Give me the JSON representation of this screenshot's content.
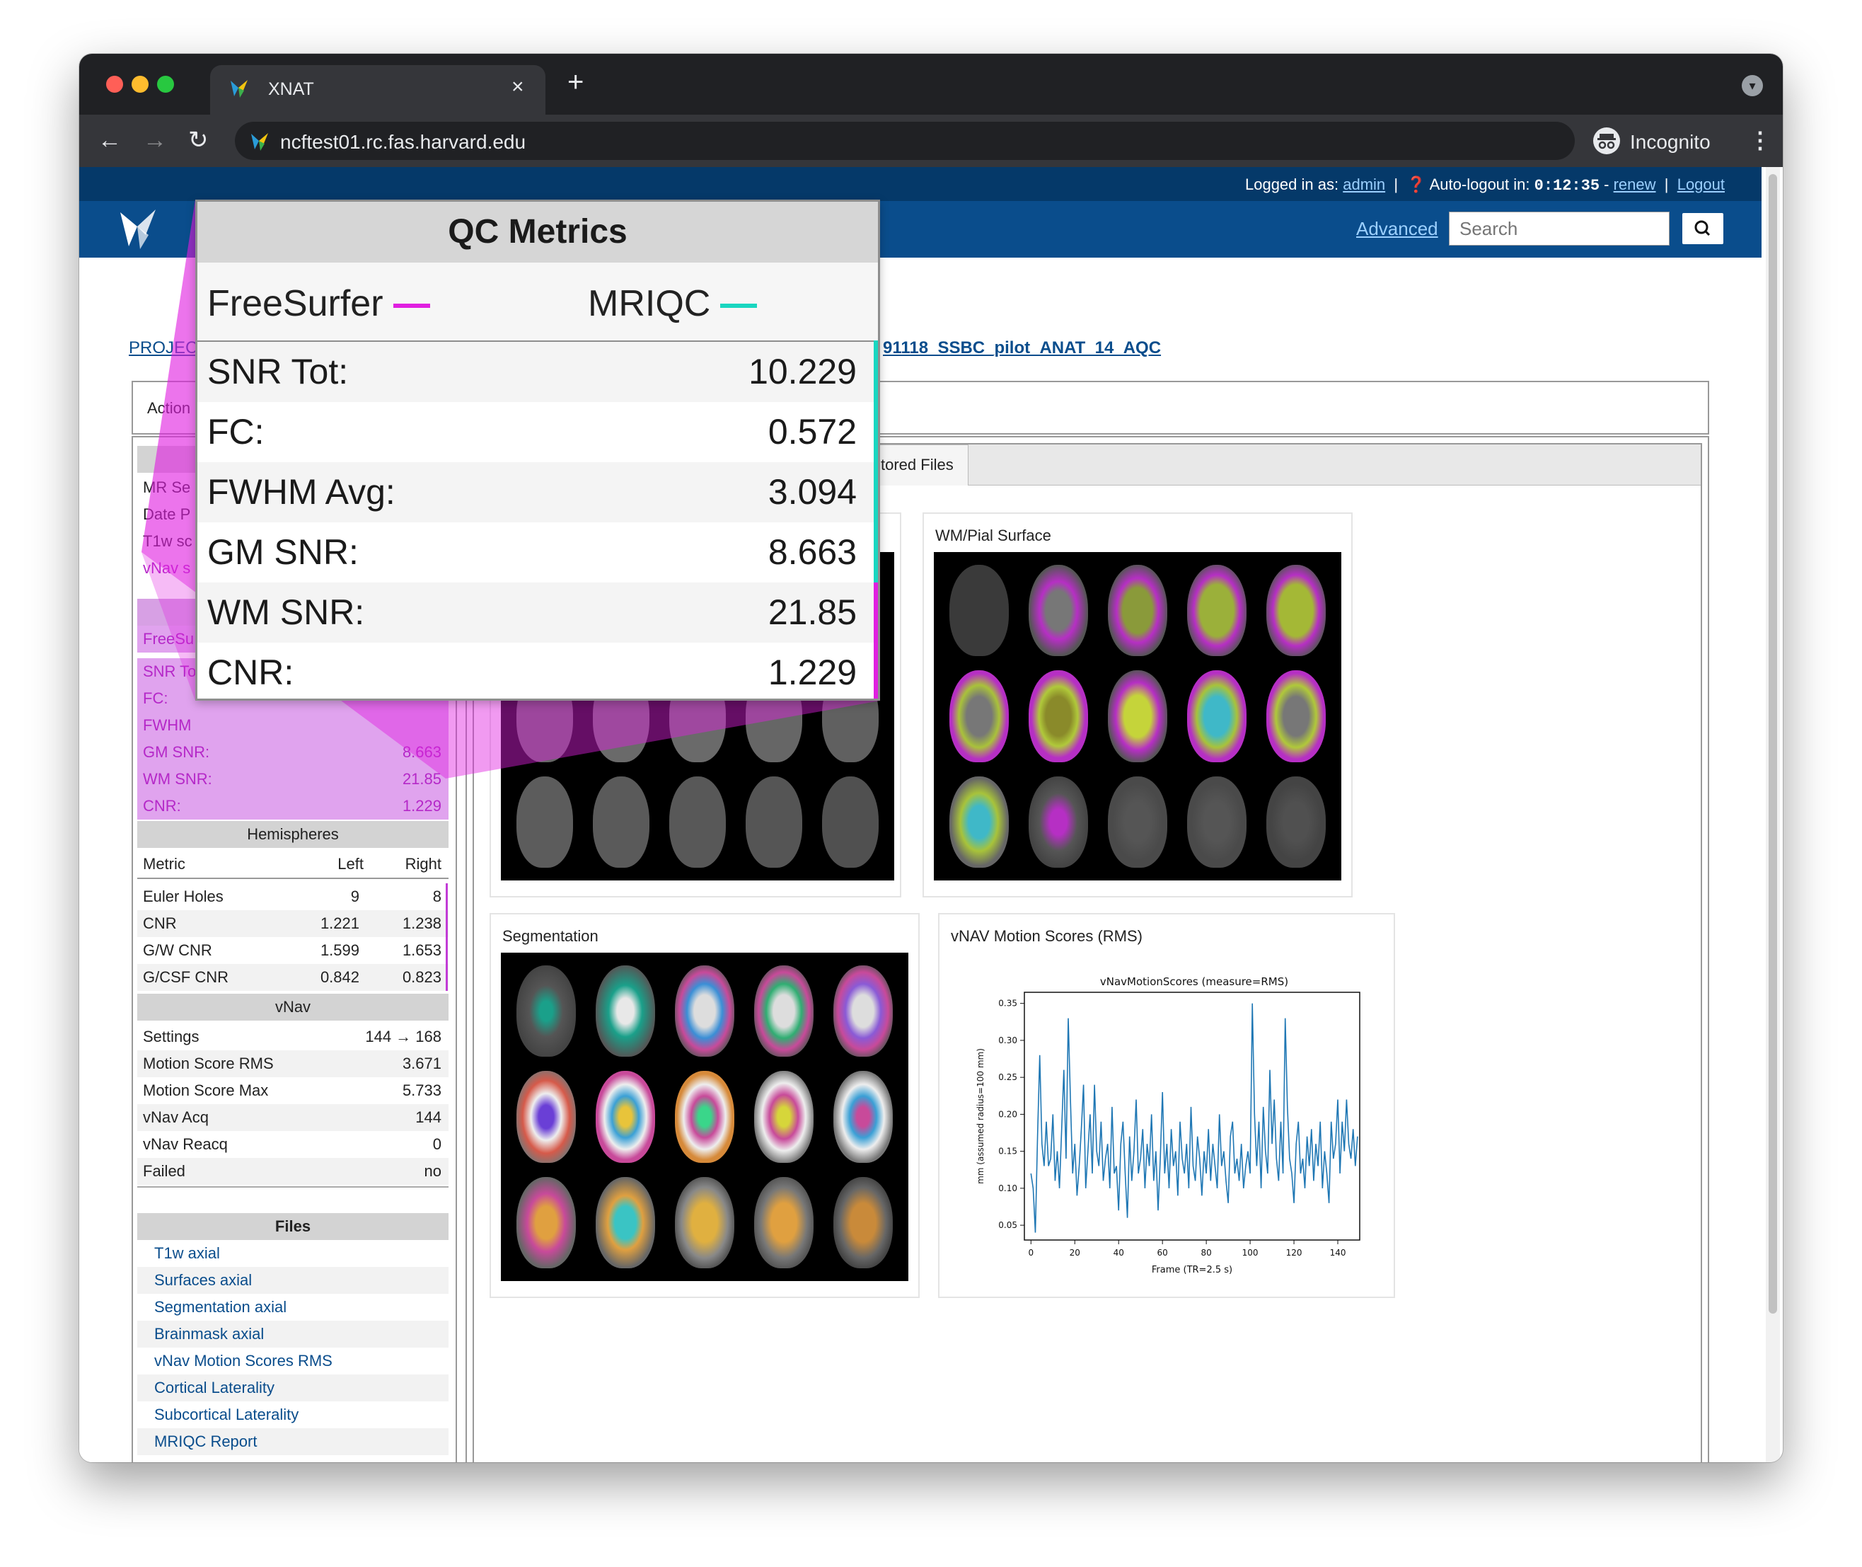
{
  "browser": {
    "tab_title": "XNAT",
    "url": "ncftest01.rc.fas.harvard.edu",
    "incognito_label": "Incognito",
    "tab_close": "×",
    "new_tab": "+"
  },
  "xnat": {
    "logged_in_label": "Logged in as:",
    "user": "admin",
    "autologout_label": "Auto-logout in:",
    "autologout_time": "0:12:35",
    "renew": "renew",
    "logout": "Logout",
    "advanced": "Advanced",
    "search_placeholder": "Search",
    "breadcrumb_project": "PROJEC",
    "breadcrumb_experiment": "91118_SSBC_pilot_ANAT_14_AQC",
    "actions_label": "Action",
    "tab_stored_files": "tored Files"
  },
  "left_panel": {
    "session_rows": [
      {
        "key": "MR Se"
      },
      {
        "key": "Date P"
      },
      {
        "key": "T1w sc"
      },
      {
        "key": "vNav s"
      }
    ],
    "freesurfer_label": "FreeSu",
    "qc_rows": [
      {
        "key": "SNR To",
        "value": ""
      },
      {
        "key": "FC:",
        "value": ""
      },
      {
        "key": "FWHM",
        "value": ""
      },
      {
        "key": "GM SNR:",
        "value": "8.663"
      },
      {
        "key": "WM SNR:",
        "value": "21.85"
      },
      {
        "key": "CNR:",
        "value": "1.229"
      }
    ],
    "hemispheres": {
      "title": "Hemispheres",
      "header": {
        "metric": "Metric",
        "left": "Left",
        "right": "Right"
      },
      "rows": [
        {
          "metric": "Euler Holes",
          "left": "9",
          "right": "8"
        },
        {
          "metric": "CNR",
          "left": "1.221",
          "right": "1.238"
        },
        {
          "metric": "G/W CNR",
          "left": "1.599",
          "right": "1.653"
        },
        {
          "metric": "G/CSF CNR",
          "left": "0.842",
          "right": "0.823"
        }
      ]
    },
    "vnav": {
      "title": "vNav",
      "rows": [
        {
          "key": "Settings",
          "value": "144 → 168"
        },
        {
          "key": "Motion Score RMS",
          "value": "3.671"
        },
        {
          "key": "Motion Score Max",
          "value": "5.733"
        },
        {
          "key": "vNav Acq",
          "value": "144"
        },
        {
          "key": "vNav Reacq",
          "value": "0"
        },
        {
          "key": "Failed",
          "value": "no"
        }
      ]
    },
    "files": {
      "title": "Files",
      "links": [
        "T1w axial",
        "Surfaces axial",
        "Segmentation axial",
        "Brainmask axial",
        "vNav Motion Scores RMS",
        "Cortical Laterality",
        "Subcortical Laterality",
        "MRIQC Report"
      ]
    }
  },
  "cards": {
    "wm_pial": "WM/Pial Surface",
    "segmentation": "Segmentation",
    "vnav_motion": "vNAV Motion Scores (RMS)"
  },
  "qc_popup": {
    "title": "QC Metrics",
    "legend_freesurfer": "FreeSurfer",
    "legend_mriqc": "MRIQC",
    "freesurfer_color": "#e01fe0",
    "mriqc_color": "#19d6c0",
    "rows": [
      {
        "key": "SNR Tot:",
        "value": "10.229"
      },
      {
        "key": "FC:",
        "value": "0.572"
      },
      {
        "key": "FWHM Avg:",
        "value": "3.094"
      },
      {
        "key": "GM SNR:",
        "value": "8.663"
      },
      {
        "key": "WM SNR:",
        "value": "21.85"
      },
      {
        "key": "CNR:",
        "value": "1.229"
      }
    ]
  },
  "chart_data": {
    "type": "line",
    "title": "vNavMotionScores (measure=RMS)",
    "xlabel": "Frame (TR=2.5 s)",
    "ylabel": "mm (assumed radius=100 mm)",
    "xlim": [
      -3,
      150
    ],
    "ylim": [
      0.03,
      0.365
    ],
    "xticks": [
      0,
      20,
      40,
      60,
      80,
      100,
      120,
      140
    ],
    "yticks": [
      0.05,
      0.1,
      0.15,
      0.2,
      0.25,
      0.3,
      0.35
    ],
    "line_color": "#1f77b4",
    "grid": false,
    "series": [
      {
        "values": [
          0.12,
          0.1,
          0.04,
          0.17,
          0.28,
          0.16,
          0.13,
          0.19,
          0.13,
          0.14,
          0.2,
          0.11,
          0.15,
          0.1,
          0.18,
          0.26,
          0.14,
          0.33,
          0.22,
          0.12,
          0.16,
          0.09,
          0.13,
          0.18,
          0.24,
          0.1,
          0.15,
          0.2,
          0.12,
          0.24,
          0.15,
          0.13,
          0.19,
          0.11,
          0.14,
          0.16,
          0.1,
          0.21,
          0.12,
          0.13,
          0.07,
          0.16,
          0.19,
          0.12,
          0.06,
          0.17,
          0.11,
          0.15,
          0.22,
          0.12,
          0.14,
          0.18,
          0.1,
          0.16,
          0.13,
          0.2,
          0.11,
          0.15,
          0.07,
          0.14,
          0.23,
          0.12,
          0.16,
          0.1,
          0.18,
          0.13,
          0.15,
          0.09,
          0.19,
          0.14,
          0.12,
          0.16,
          0.1,
          0.21,
          0.13,
          0.11,
          0.17,
          0.14,
          0.09,
          0.15,
          0.12,
          0.18,
          0.11,
          0.16,
          0.13,
          0.1,
          0.2,
          0.13,
          0.15,
          0.11,
          0.08,
          0.17,
          0.19,
          0.12,
          0.14,
          0.11,
          0.16,
          0.1,
          0.13,
          0.15,
          0.12,
          0.35,
          0.2,
          0.13,
          0.19,
          0.1,
          0.21,
          0.15,
          0.12,
          0.26,
          0.16,
          0.22,
          0.14,
          0.11,
          0.19,
          0.12,
          0.33,
          0.21,
          0.14,
          0.12,
          0.08,
          0.16,
          0.19,
          0.12,
          0.14,
          0.1,
          0.17,
          0.13,
          0.18,
          0.11,
          0.16,
          0.13,
          0.19,
          0.1,
          0.15,
          0.12,
          0.08,
          0.19,
          0.14,
          0.16,
          0.22,
          0.12,
          0.19,
          0.15,
          0.22,
          0.16,
          0.14,
          0.18,
          0.13,
          0.17
        ]
      }
    ]
  }
}
